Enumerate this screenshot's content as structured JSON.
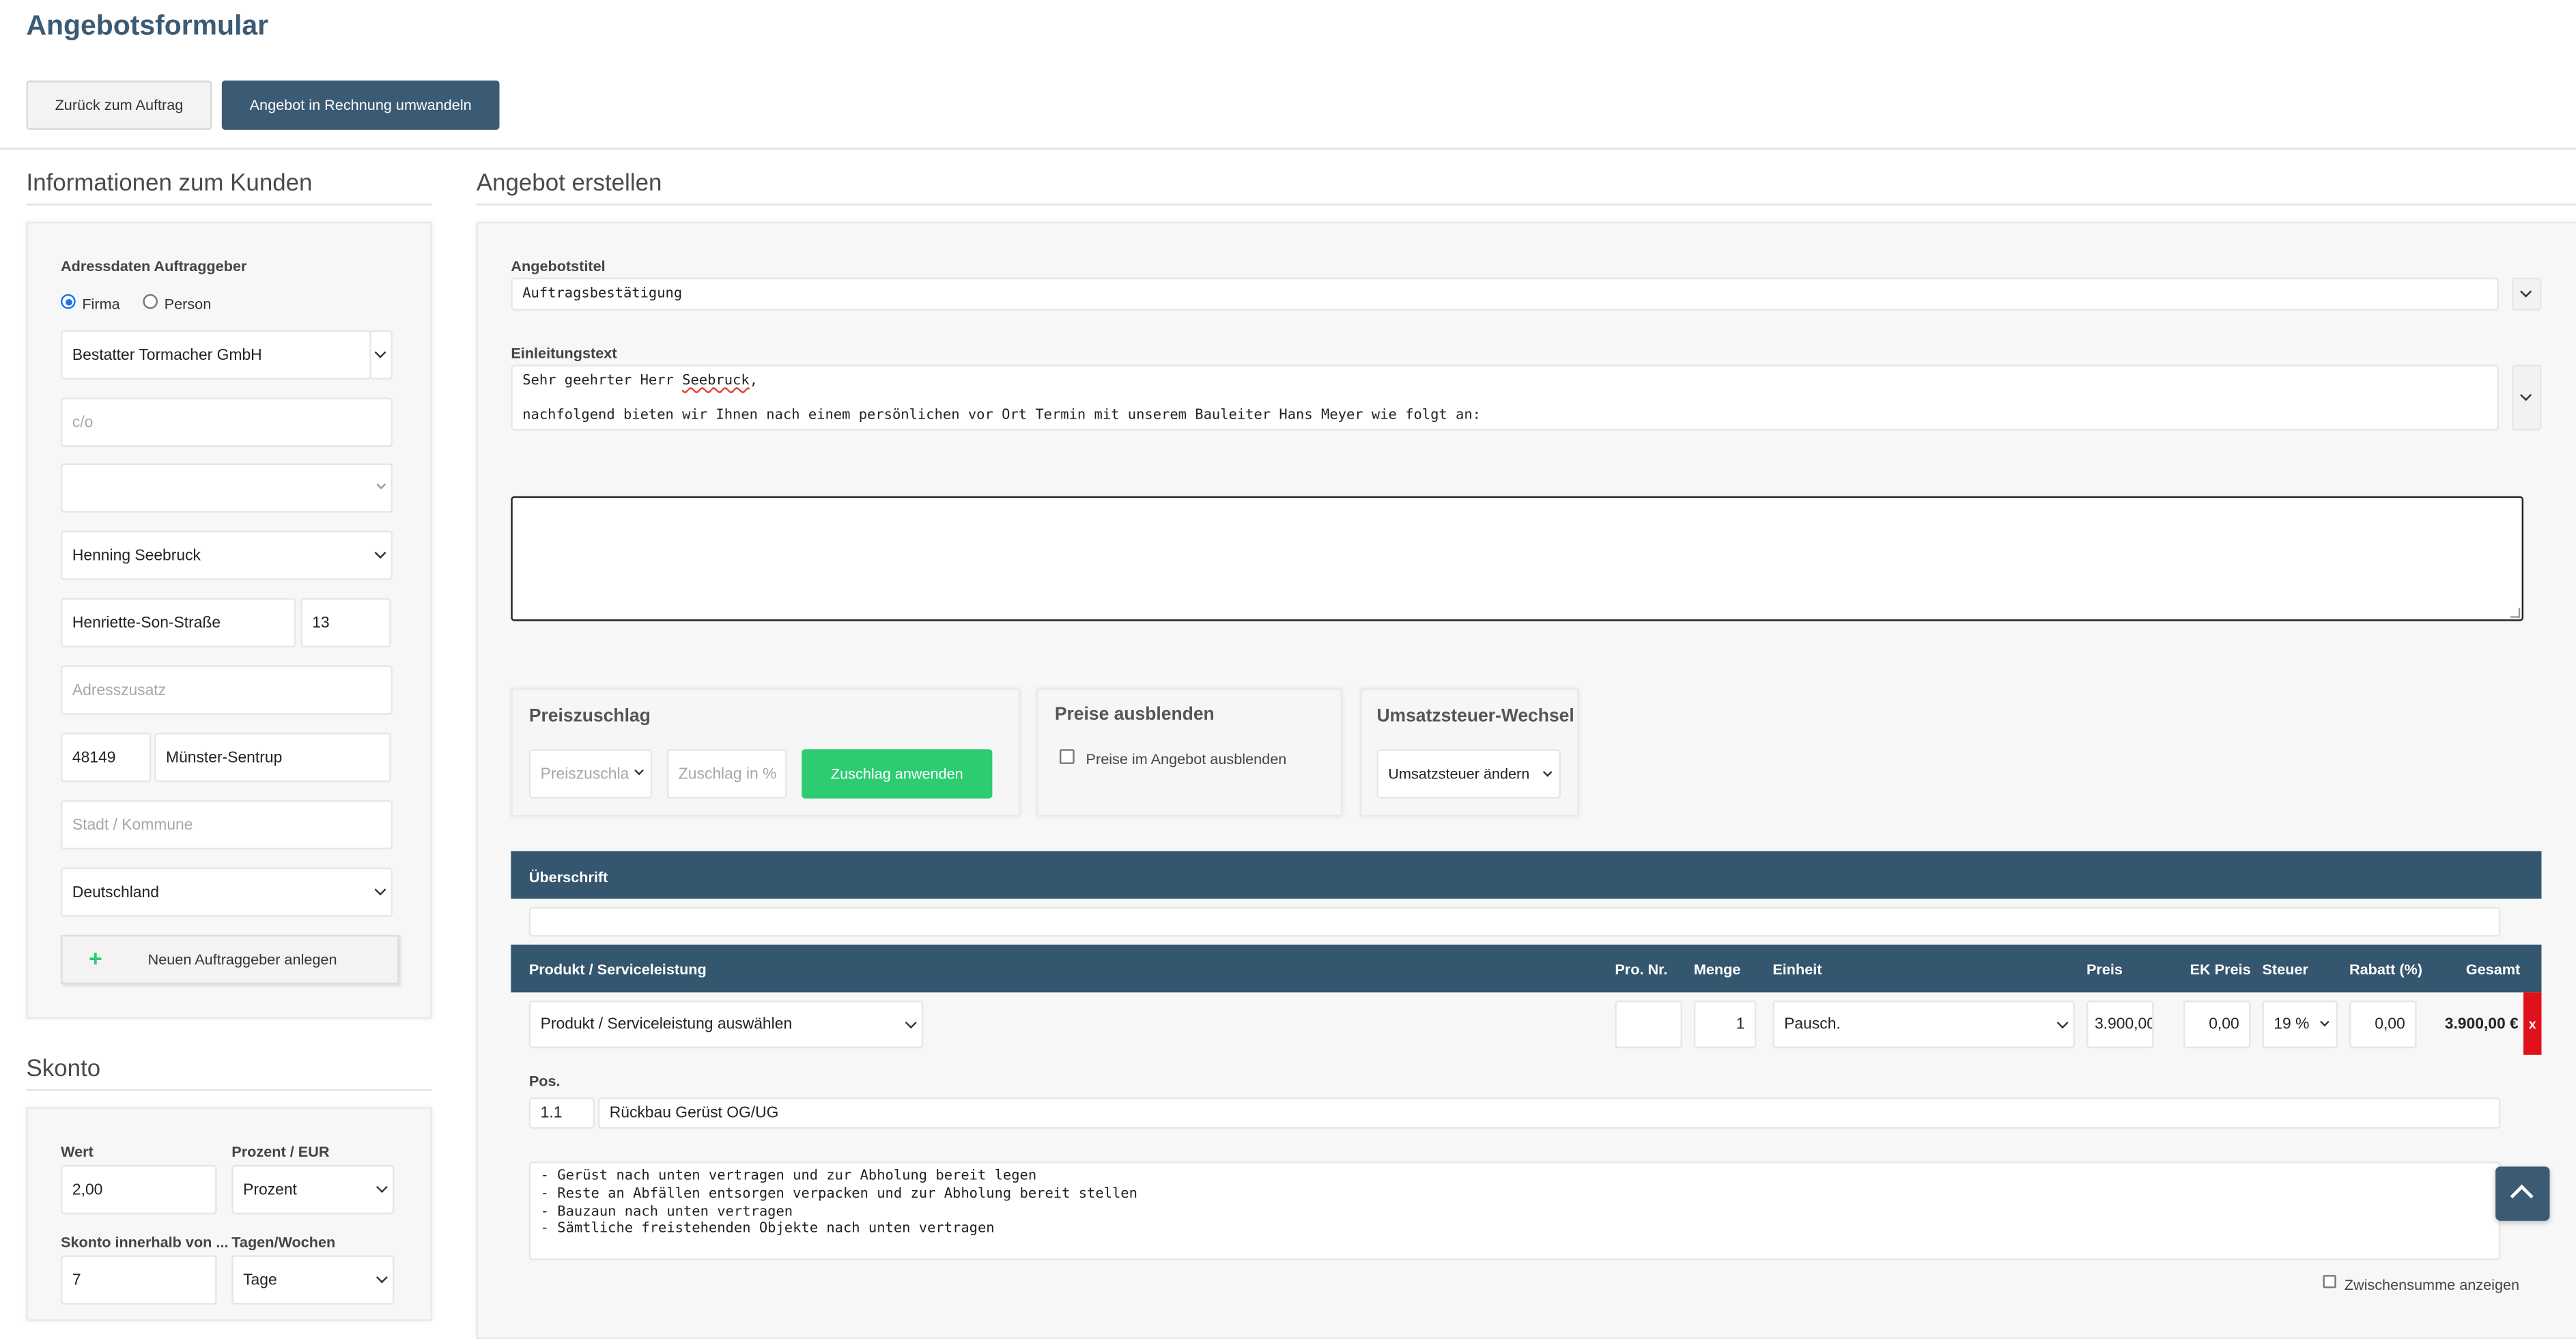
{
  "page": {
    "title": "Angebotsformular",
    "back_button": "Zurück zum Auftrag",
    "convert_button": "Angebot in Rechnung umwandeln"
  },
  "customer": {
    "section_title": "Informationen zum Kunden",
    "address_label": "Adressdaten Auftraggeber",
    "radio_company": "Firma",
    "radio_person": "Person",
    "company_value": "Bestatter Tormacher GmbH",
    "co_placeholder": "c/o",
    "salutation_value": "",
    "contact_value": "Henning Seebruck",
    "street_value": "Henriette-Son-Straße",
    "house_no_value": "13",
    "address_extra_placeholder": "Adresszusatz",
    "zip_value": "48149",
    "city_value": "Münster-Sentrup",
    "municipality_placeholder": "Stadt / Kommune",
    "country_value": "Deutschland",
    "new_client_button": "Neuen Auftraggeber anlegen",
    "new_client_icon": "+"
  },
  "skonto": {
    "section_title": "Skonto",
    "value_label": "Wert",
    "value": "2,00",
    "type_label": "Prozent / EUR",
    "type_value": "Prozent",
    "within_label": "Skonto innerhalb von ...",
    "within_value": "7",
    "unit_label": "Tagen/Wochen",
    "unit_value": "Tage"
  },
  "offer": {
    "section_title": "Angebot erstellen",
    "title_label": "Angebotstitel",
    "title_value": "Auftragsbestätigung",
    "intro_label": "Einleitungstext",
    "intro_line1_prefix": "Sehr geehrter Herr ",
    "intro_line1_name": "Seebruck",
    "intro_line1_suffix": ",",
    "intro_line2": "nachfolgend bieten wir Ihnen nach einem persönlichen vor Ort Termin mit unserem Bauleiter Hans Meyer wie folgt an:",
    "free_text_value": ""
  },
  "surcharge": {
    "title": "Preiszuschlag",
    "select_placeholder": "Preiszuschla",
    "percent_placeholder": "Zuschlag in %",
    "apply_button": "Zuschlag anwenden"
  },
  "hide_prices": {
    "title": "Preise ausblenden",
    "checkbox_label": "Preise im Angebot ausblenden"
  },
  "vat_change": {
    "title": "Umsatzsteuer-Wechsel",
    "select_value": "Umsatzsteuer ändern"
  },
  "heading_bar": {
    "label": "Überschrift",
    "input_value": ""
  },
  "table": {
    "headers": {
      "product": "Produkt / Serviceleistung",
      "pro_nr": "Pro. Nr.",
      "qty": "Menge",
      "unit": "Einheit",
      "price": "Preis",
      "ek_price": "EK Preis",
      "tax": "Steuer",
      "discount": "Rabatt (%)",
      "total": "Gesamt"
    },
    "row": {
      "product_select": "Produkt / Serviceleistung auswählen",
      "pro_nr": "",
      "qty": "1",
      "unit": "Pausch.",
      "price": "3.900,00",
      "ek_price": "0,00",
      "tax": "19 %",
      "discount": "0,00",
      "total": "3.900,00 €",
      "delete": "x",
      "pos_label": "Pos.",
      "pos_value": "1.1",
      "name_value": "Rückbau Gerüst OG/UG",
      "description": [
        "- Gerüst nach unten vertragen und zur Abholung bereit legen",
        "- Reste an Abfällen entsorgen verpacken und zur Abholung bereit stellen",
        "- Bauzaun nach unten vertragen",
        "- Sämtliche freistehenden Objekte nach unten vertragen"
      ],
      "subtotal_label": "Zwischensumme anzeigen"
    }
  },
  "colors": {
    "primary": "#3b5a74",
    "table_header": "#34566f",
    "success": "#2ecc71",
    "danger": "#e0111b",
    "title": "#3b5a74"
  }
}
